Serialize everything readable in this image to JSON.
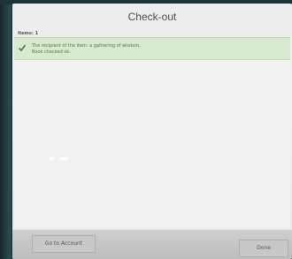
{
  "window": {
    "title": "Check-out"
  },
  "summary": {
    "items_label": "Items: 1"
  },
  "notice": {
    "line1": "The recipient of the item: a gathering of wisdom.",
    "line2": "Book checked ok.",
    "icon": "check-icon",
    "color": "#4f7a44"
  },
  "footer": {
    "account_button_label": "Go to Account",
    "done_button_label": "Done"
  }
}
